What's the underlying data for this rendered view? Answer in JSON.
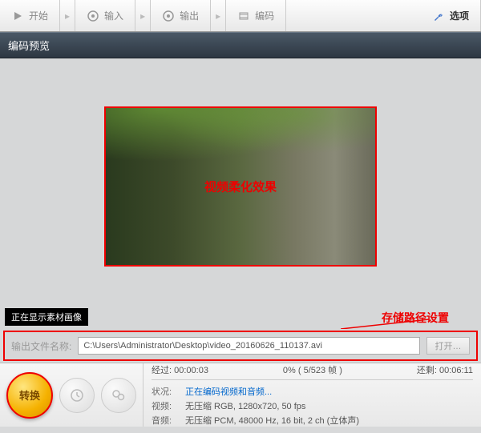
{
  "toolbar": {
    "start": "开始",
    "input": "输入",
    "output": "输出",
    "encode": "编码",
    "options": "选项"
  },
  "panel": {
    "title": "编码预览"
  },
  "preview": {
    "overlay": "视频柔化效果",
    "status": "正在显示素材画像"
  },
  "annotation": "存储路径设置",
  "output": {
    "label": "输出文件名称:",
    "path": "C:\\Users\\Administrator\\Desktop\\video_20160626_110137.avi",
    "browse": "打开…"
  },
  "convert_btn": "转换",
  "progress": {
    "elapsed_label": "经过:",
    "elapsed": "00:00:03",
    "percent": "0% ( 5/523 帧 )",
    "remaining_label": "还剩:",
    "remaining": "00:06:11",
    "status_label": "状况:",
    "status": "正在编码视频和音频...",
    "video_label": "视频:",
    "video": "无压缩 RGB, 1280x720, 50 fps",
    "audio_label": "音频:",
    "audio": "无压缩 PCM, 48000 Hz, 16 bit, 2 ch (立体声)"
  }
}
